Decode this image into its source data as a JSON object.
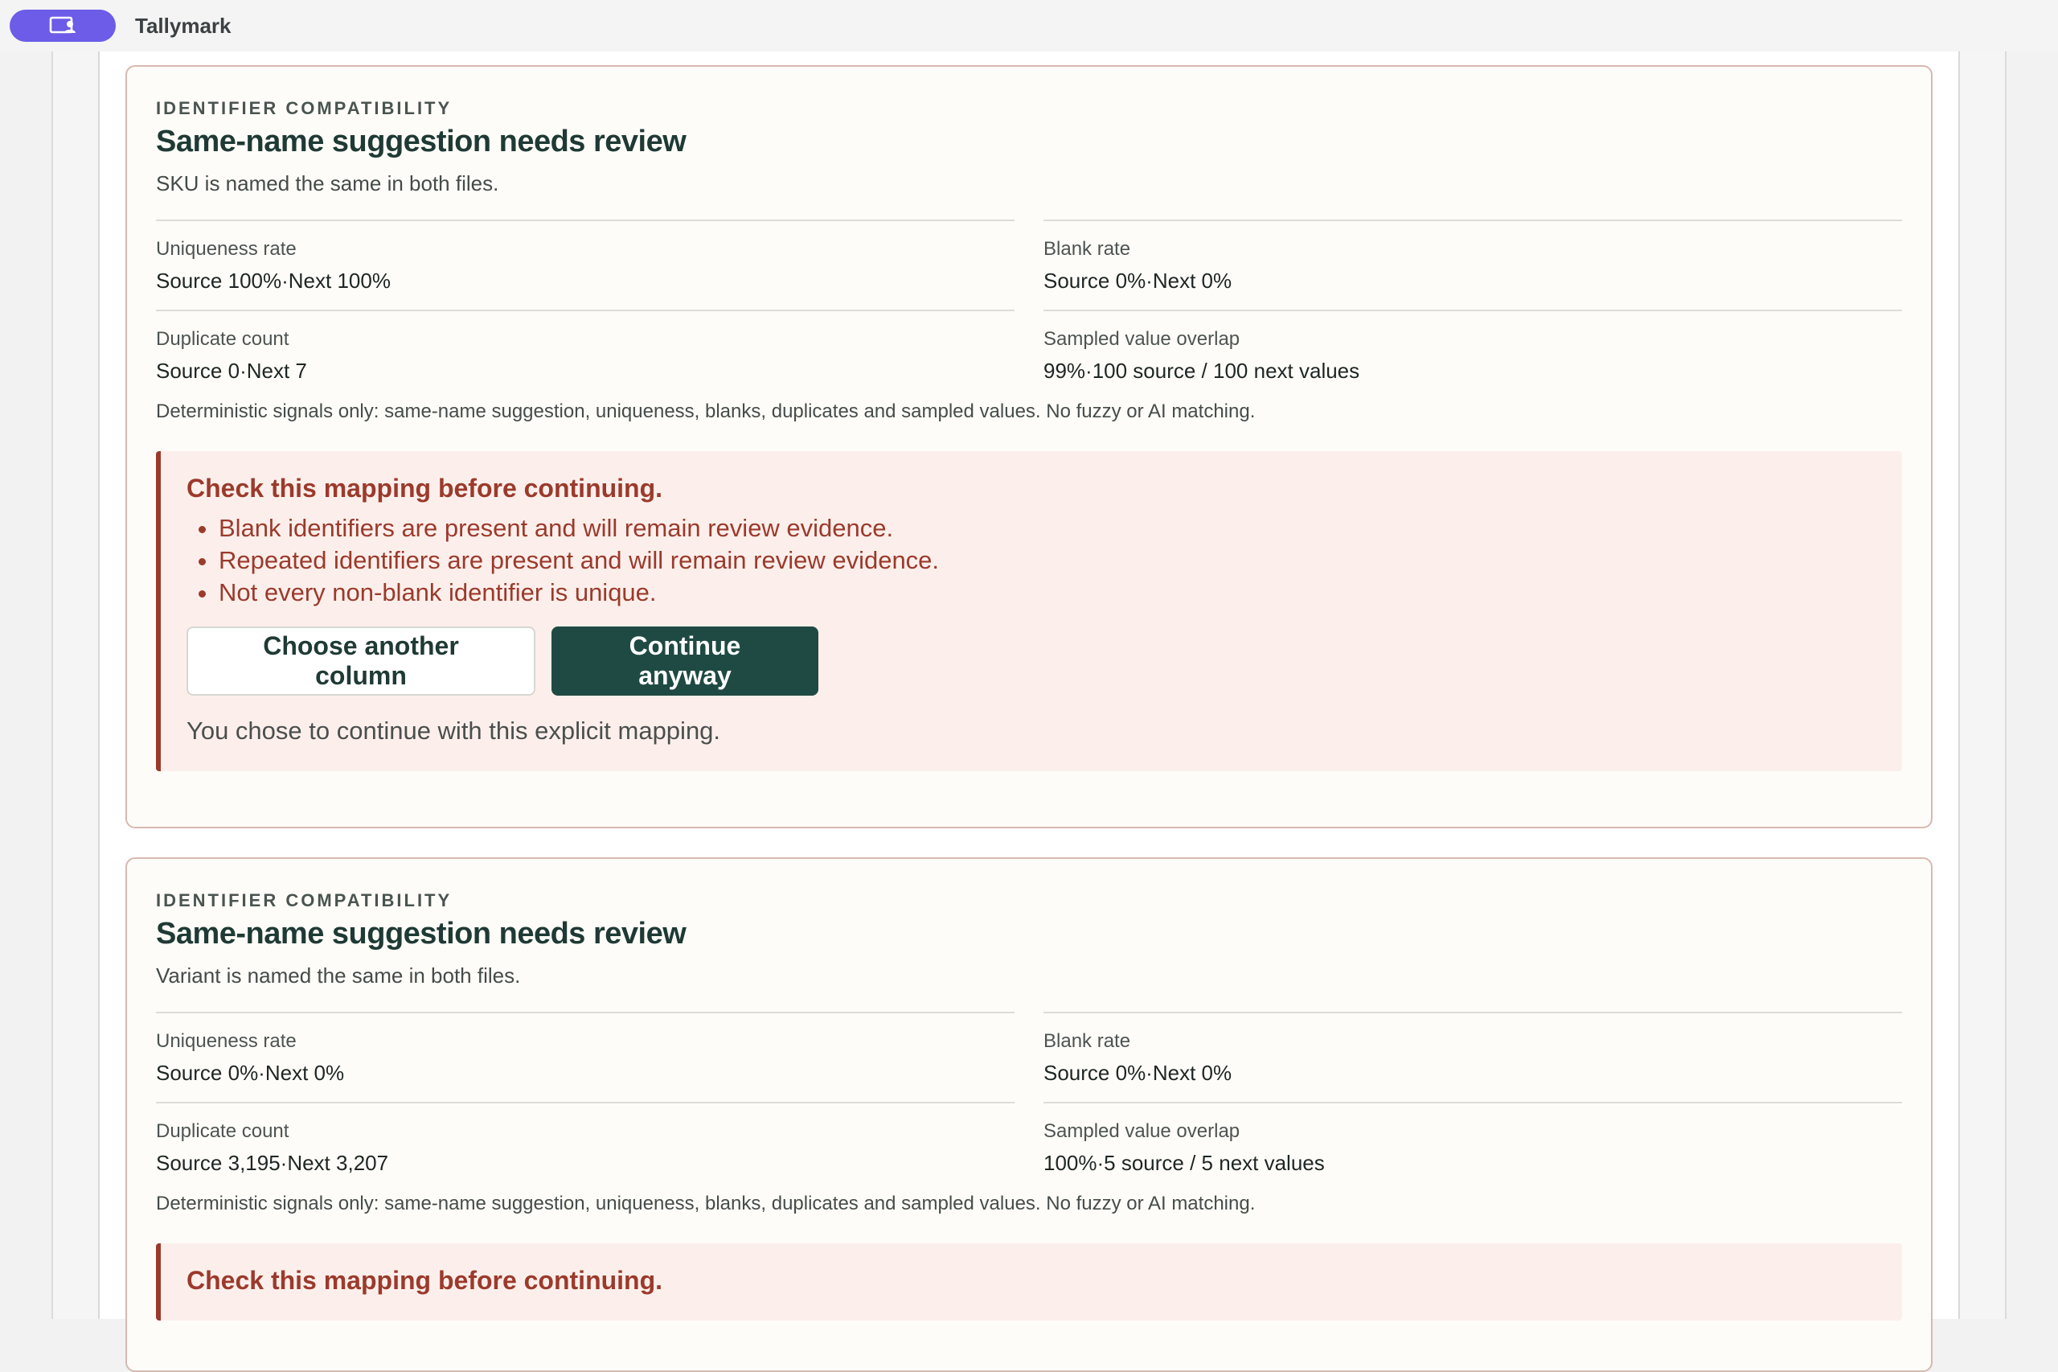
{
  "app": {
    "title": "Tallymark",
    "launcher_icon": "user-screen-icon",
    "accent": "#6c5ce7"
  },
  "cards": [
    {
      "eyebrow": "IDENTIFIER COMPATIBILITY",
      "title": "Same-name suggestion needs review",
      "description": "SKU is named the same in both files.",
      "metrics": [
        {
          "label": "Uniqueness rate",
          "value": "Source 100%·Next 100%"
        },
        {
          "label": "Blank rate",
          "value": "Source 0%·Next 0%"
        },
        {
          "label": "Duplicate count",
          "value": "Source 0·Next 7"
        },
        {
          "label": "Sampled value overlap",
          "value": "99%·100 source / 100 next values"
        }
      ],
      "note": "Deterministic signals only: same-name suggestion, uniqueness, blanks, duplicates and sampled values. No fuzzy or AI matching.",
      "alert": {
        "title": "Check this mapping before continuing.",
        "items": [
          "Blank identifiers are present and will remain review evidence.",
          "Repeated identifiers are present and will remain review evidence.",
          "Not every non-blank identifier is unique."
        ],
        "secondary_button": "Choose another column",
        "primary_button": "Continue anyway",
        "footnote": "You chose to continue with this explicit mapping."
      }
    },
    {
      "eyebrow": "IDENTIFIER COMPATIBILITY",
      "title": "Same-name suggestion needs review",
      "description": "Variant is named the same in both files.",
      "metrics": [
        {
          "label": "Uniqueness rate",
          "value": "Source 0%·Next 0%"
        },
        {
          "label": "Blank rate",
          "value": "Source 0%·Next 0%"
        },
        {
          "label": "Duplicate count",
          "value": "Source 3,195·Next 3,207"
        },
        {
          "label": "Sampled value overlap",
          "value": "100%·5 source / 5 next values"
        }
      ],
      "note": "Deterministic signals only: same-name suggestion, uniqueness, blanks, duplicates and sampled values. No fuzzy or AI matching.",
      "alert": {
        "title": "Check this mapping before continuing."
      }
    }
  ],
  "colors": {
    "warning_text": "#9b3a2c",
    "warning_bg": "#fcefeb",
    "primary_button": "#1f4a43",
    "card_bg": "#fefcf8"
  }
}
